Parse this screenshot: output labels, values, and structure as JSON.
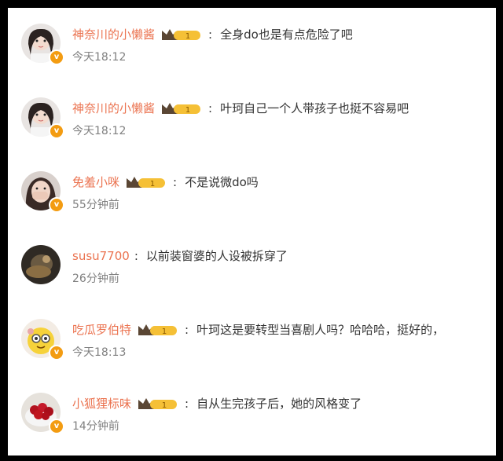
{
  "comments": [
    {
      "username": "神奈川的小懒酱",
      "has_level_badge": true,
      "level": "1",
      "text": "全身do也是有点危险了吧",
      "time": "今天18:12",
      "avatar": "girl-portrait"
    },
    {
      "username": "神奈川的小懒酱",
      "has_level_badge": true,
      "level": "1",
      "text": "叶珂自己一个人带孩子也挺不容易吧",
      "time": "今天18:12",
      "avatar": "girl-portrait"
    },
    {
      "username": "免羞小咪",
      "has_level_badge": true,
      "level": "1",
      "text": "不是说微do吗",
      "time": "55分钟前",
      "avatar": "girl-covering-face"
    },
    {
      "username": "susu7700",
      "has_level_badge": false,
      "level": "",
      "text": "以前装窗婆的人设被拆穿了",
      "time": "26分钟前",
      "avatar": "dark-photo"
    },
    {
      "username": "吃瓜罗伯特",
      "has_level_badge": true,
      "level": "1",
      "text": "叶珂这是要转型当喜剧人吗？哈哈哈，挺好的，",
      "time": "今天18:13",
      "avatar": "yellow-cartoon"
    },
    {
      "username": "小狐狸标味",
      "has_level_badge": true,
      "level": "1",
      "text": "自从生完孩子后，她的风格变了",
      "time": "14分钟前",
      "avatar": "cherries-bowl"
    }
  ],
  "colors": {
    "username": "#eb7350",
    "text": "#333333",
    "time": "#808080",
    "verified_badge": "#f39c12",
    "crown_gold": "#f5c036",
    "crown_dark": "#5a4634"
  },
  "icons": {
    "verified": "v-verified-icon",
    "level": "crown-level-icon"
  }
}
